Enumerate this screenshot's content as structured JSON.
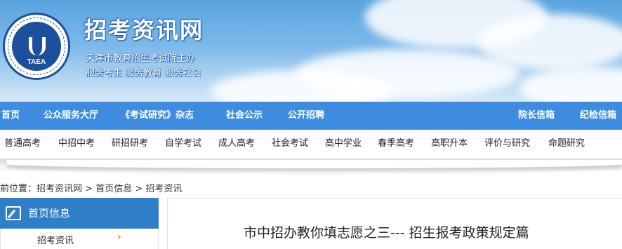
{
  "header": {
    "logo_text": "TAEA",
    "title": "招考资讯网",
    "subtitle1": "天津市教育招生考试院主办",
    "subtitle2": "服务考生 服务教育 服务社会"
  },
  "main_nav": {
    "items": [
      "首页",
      "公众服务大厅",
      "《考试研究》杂志",
      "社会公示",
      "公开招聘",
      "院长信箱",
      "纪检信箱"
    ]
  },
  "sub_nav": {
    "items": [
      "普通高考",
      "中招中考",
      "研招研考",
      "自学考试",
      "成人高考",
      "社会考试",
      "高中学业",
      "春季高考",
      "高职升本",
      "评价与研究",
      "命题研究"
    ]
  },
  "breadcrumb": {
    "prefix": "前位置：",
    "items": [
      "招考资讯网",
      "首页信息",
      "招考资讯"
    ],
    "separator": " > "
  },
  "sidebar": {
    "heading": "首页信息",
    "items": [
      {
        "label": "招考资讯",
        "arrow": "›"
      }
    ]
  },
  "article": {
    "title": "市中招办教你填志愿之三--- 招生报考政策规定篇"
  },
  "colors": {
    "nav_bg": "#3d8ce0",
    "side_head_bg": "#2f7fc8",
    "arrow": "#f08c00"
  }
}
